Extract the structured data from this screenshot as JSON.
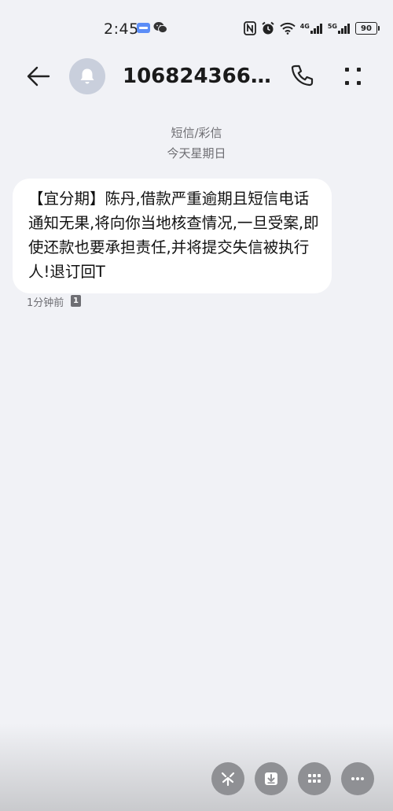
{
  "status_bar": {
    "time": "2:45",
    "network_4g": "4G",
    "network_5g": "5G",
    "battery": "90"
  },
  "header": {
    "contact_name": "1068243668…",
    "icons": [
      "back-arrow-icon",
      "bell-icon",
      "phone-icon",
      "more-vertical-icon"
    ]
  },
  "conversation": {
    "channel_label": "短信/彩信",
    "date_label": "今天星期日",
    "messages": [
      {
        "text": "【宜分期】陈丹,借款严重逾期且短信电话通知无果,将向你当地核查情况,一旦受案,即使还款也要承担责任,并将提交失信被执行人!退订回T",
        "time": "1分钟前",
        "sim": "1"
      }
    ]
  },
  "bottom_actions": [
    "sparkle-icon",
    "download-icon",
    "grid-icon",
    "more-horizontal-icon"
  ]
}
